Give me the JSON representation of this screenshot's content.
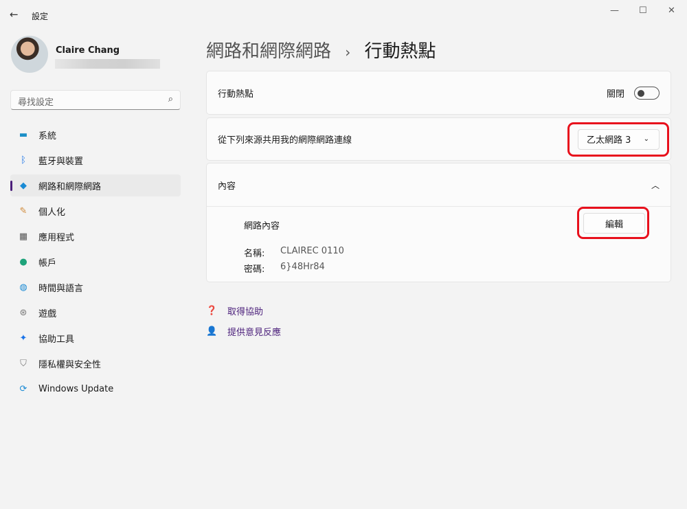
{
  "window": {
    "title": "設定",
    "minimize": "—",
    "maximize": "☐",
    "close": "✕"
  },
  "user": {
    "name": "Claire Chang"
  },
  "search": {
    "placeholder": "尋找設定"
  },
  "sidebar": {
    "items": [
      {
        "label": "系統",
        "icon": "▬",
        "color": "#1b8fc7"
      },
      {
        "label": "藍牙與裝置",
        "icon": "ᛒ",
        "color": "#1a73e8"
      },
      {
        "label": "網路和網際網路",
        "icon": "◆",
        "color": "#1a8ad4"
      },
      {
        "label": "個人化",
        "icon": "✎",
        "color": "#d08a3a"
      },
      {
        "label": "應用程式",
        "icon": "▦",
        "color": "#555"
      },
      {
        "label": "帳戶",
        "icon": "●",
        "color": "#1ea37a"
      },
      {
        "label": "時間與語言",
        "icon": "◍",
        "color": "#1a8ad4"
      },
      {
        "label": "遊戲",
        "icon": "⊛",
        "color": "#777"
      },
      {
        "label": "協助工具",
        "icon": "✦",
        "color": "#1a73e8"
      },
      {
        "label": "隱私權與安全性",
        "icon": "⛉",
        "color": "#777"
      },
      {
        "label": "Windows Update",
        "icon": "⟳",
        "color": "#1a8ad4"
      }
    ]
  },
  "breadcrumb": {
    "parent": "網路和網際網路",
    "sep": "›",
    "current": "行動熱點"
  },
  "hotspot": {
    "label": "行動熱點",
    "state": "關閉"
  },
  "share": {
    "label": "從下列來源共用我的網際網路連線",
    "selected": "乙太網路 3"
  },
  "properties": {
    "header": "內容",
    "section": "網路內容",
    "edit": "編輯",
    "name_label": "名稱:",
    "name_value": "CLAIREC 0110",
    "password_label": "密碼:",
    "password_value": "6}48Hr84"
  },
  "links": {
    "help": "取得協助",
    "feedback": "提供意見反應"
  }
}
